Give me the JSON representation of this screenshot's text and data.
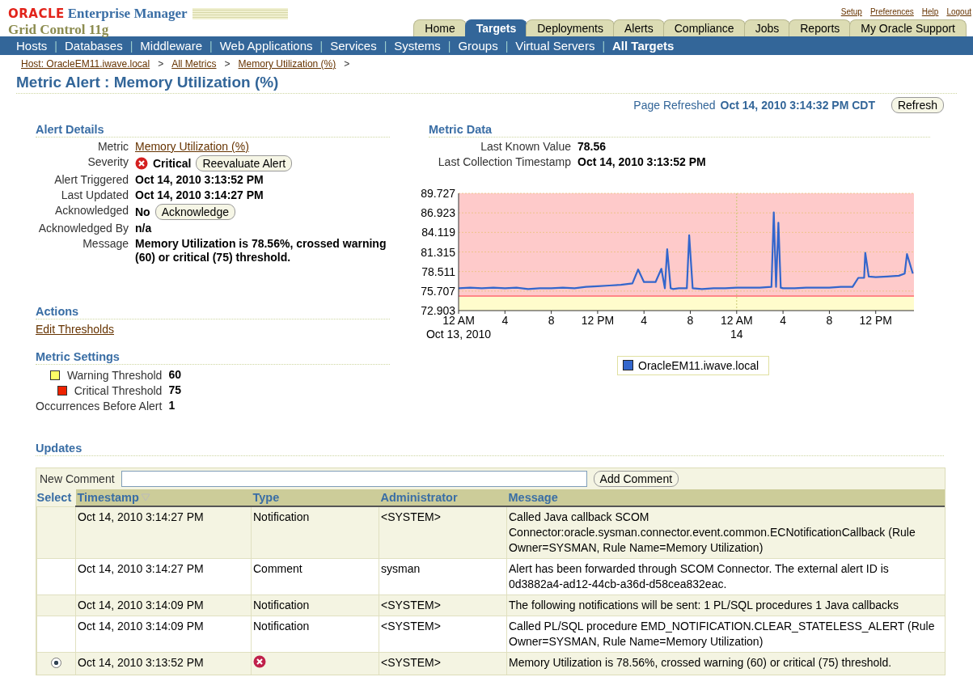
{
  "brand": {
    "vendor": "ORACLE",
    "product": "Enterprise Manager",
    "edition": "Grid Control 11g"
  },
  "global_links": [
    "Setup",
    "Preferences",
    "Help",
    "Logout"
  ],
  "tabs": [
    {
      "label": "Home",
      "selected": false
    },
    {
      "label": "Targets",
      "selected": true
    },
    {
      "label": "Deployments",
      "selected": false
    },
    {
      "label": "Alerts",
      "selected": false
    },
    {
      "label": "Compliance",
      "selected": false
    },
    {
      "label": "Jobs",
      "selected": false
    },
    {
      "label": "Reports",
      "selected": false
    },
    {
      "label": "My Oracle Support",
      "selected": false
    }
  ],
  "subnav": [
    {
      "label": "Hosts",
      "selected": false
    },
    {
      "label": "Databases",
      "selected": false
    },
    {
      "label": "Middleware",
      "selected": false
    },
    {
      "label": "Web Applications",
      "selected": false
    },
    {
      "label": "Services",
      "selected": false
    },
    {
      "label": "Systems",
      "selected": false
    },
    {
      "label": "Groups",
      "selected": false
    },
    {
      "label": "Virtual Servers",
      "selected": false
    },
    {
      "label": "All Targets",
      "selected": true
    }
  ],
  "breadcrumbs": [
    "Host: OracleEM11.iwave.local",
    "All Metrics",
    "Memory Utilization (%)"
  ],
  "subnav_separator": "|",
  "breadcrumb_separator": ">",
  "page_title": "Metric Alert : Memory Utilization (%)",
  "refresh": {
    "label": "Page Refreshed",
    "time": "Oct 14, 2010 3:14:32 PM CDT",
    "button": "Refresh"
  },
  "alert_details": {
    "title": "Alert Details",
    "rows": [
      {
        "label": "Metric",
        "value": "Memory Utilization (%)",
        "kind": "link"
      },
      {
        "label": "Severity",
        "value": "Critical",
        "kind": "severity",
        "button": "Reevaluate Alert"
      },
      {
        "label": "Alert Triggered",
        "value": "Oct 14, 2010 3:13:52 PM",
        "kind": "text"
      },
      {
        "label": "Last Updated",
        "value": "Oct 14, 2010 3:14:27 PM",
        "kind": "text"
      },
      {
        "label": "Acknowledged",
        "value": "No",
        "kind": "text",
        "button": "Acknowledge"
      },
      {
        "label": "Acknowledged By",
        "value": "n/a",
        "kind": "text"
      },
      {
        "label": "Message",
        "value": "Memory Utilization is 78.56%, crossed warning (60) or critical (75) threshold.",
        "kind": "text"
      }
    ]
  },
  "actions": {
    "title": "Actions",
    "links": [
      "Edit Thresholds"
    ]
  },
  "metric_settings": {
    "title": "Metric Settings",
    "rows": [
      {
        "label": "Warning Threshold",
        "value": "60",
        "kind": "swatch",
        "color": "#ffff66"
      },
      {
        "label": "Critical Threshold",
        "value": "75",
        "kind": "swatch",
        "color": "#ee2200"
      },
      {
        "label": "Occurrences Before Alert",
        "value": "1",
        "kind": "plain"
      }
    ]
  },
  "metric_data": {
    "title": "Metric Data",
    "rows": [
      {
        "label": "Last Known Value",
        "value": "78.56"
      },
      {
        "label": "Last Collection Timestamp",
        "value": "Oct 14, 2010 3:13:52 PM"
      }
    ],
    "chart_data": {
      "type": "line",
      "grid": true,
      "xlim": [
        "2010-10-13 00:00",
        "2010-10-14 15:18"
      ],
      "ylim": [
        72.903,
        89.727
      ],
      "yticks": [
        72.903,
        75.707,
        78.511,
        81.315,
        84.119,
        86.923,
        89.727
      ],
      "xticks": [
        {
          "value": "2010-10-13 00:00",
          "label": "12 AM\nOct 13, 2010"
        },
        {
          "value": "2010-10-13 04:00",
          "label": "4"
        },
        {
          "value": "2010-10-13 08:00",
          "label": "8"
        },
        {
          "value": "2010-10-13 12:00",
          "label": "12 PM"
        },
        {
          "value": "2010-10-13 16:00",
          "label": "4"
        },
        {
          "value": "2010-10-13 20:00",
          "label": "8"
        },
        {
          "value": "2010-10-14 00:00",
          "label": "12 AM\n14"
        },
        {
          "value": "2010-10-14 04:00",
          "label": "4"
        },
        {
          "value": "2010-10-14 08:00",
          "label": "8"
        },
        {
          "value": "2010-10-14 12:00",
          "label": "12 PM"
        }
      ],
      "x": [
        "2010-10-13 00:00",
        "2010-10-13 01:00",
        "2010-10-13 02:00",
        "2010-10-13 03:00",
        "2010-10-13 04:00",
        "2010-10-13 05:00",
        "2010-10-13 06:00",
        "2010-10-13 07:00",
        "2010-10-13 08:00",
        "2010-10-13 09:00",
        "2010-10-13 10:00",
        "2010-10-13 11:00",
        "2010-10-13 12:00",
        "2010-10-13 13:00",
        "2010-10-13 14:00",
        "2010-10-13 15:00",
        "2010-10-13 15:30",
        "2010-10-13 16:00",
        "2010-10-13 17:00",
        "2010-10-13 17:30",
        "2010-10-13 17:48",
        "2010-10-13 18:00",
        "2010-10-13 18:18",
        "2010-10-13 18:30",
        "2010-10-13 19:00",
        "2010-10-13 19:42",
        "2010-10-13 19:54",
        "2010-10-13 20:12",
        "2010-10-13 21:00",
        "2010-10-13 22:00",
        "2010-10-13 23:00",
        "2010-10-14 00:00",
        "2010-10-14 01:00",
        "2010-10-14 02:00",
        "2010-10-14 03:00",
        "2010-10-14 03:12",
        "2010-10-14 03:24",
        "2010-10-14 03:36",
        "2010-10-14 03:48",
        "2010-10-14 04:00",
        "2010-10-14 05:00",
        "2010-10-14 06:00",
        "2010-10-14 07:00",
        "2010-10-14 08:00",
        "2010-10-14 09:00",
        "2010-10-14 10:00",
        "2010-10-14 10:30",
        "2010-10-14 11:00",
        "2010-10-14 11:06",
        "2010-10-14 11:24",
        "2010-10-14 12:00",
        "2010-10-14 13:00",
        "2010-10-14 14:00",
        "2010-10-14 14:30",
        "2010-10-14 14:42",
        "2010-10-14 15:12"
      ],
      "series": [
        {
          "name": "OracleEM11.iwave.local",
          "color": "#3366cc",
          "values": [
            76.1,
            76.2,
            76.1,
            76.2,
            76.1,
            76.2,
            76.0,
            76.1,
            76.1,
            76.2,
            76.1,
            76.3,
            76.4,
            76.5,
            76.6,
            76.8,
            78.8,
            77.0,
            77.0,
            78.9,
            76.1,
            81.7,
            76.1,
            76.0,
            76.1,
            76.1,
            83.7,
            76.1,
            76.0,
            76.1,
            76.1,
            76.2,
            76.2,
            76.2,
            76.3,
            87.0,
            76.3,
            85.5,
            76.2,
            76.1,
            76.1,
            76.2,
            76.2,
            76.2,
            76.3,
            76.3,
            77.6,
            77.6,
            81.2,
            77.8,
            77.7,
            77.8,
            77.9,
            78.2,
            81.0,
            78.2
          ]
        }
      ],
      "bands": [
        {
          "axis": "y",
          "from": 75,
          "to": 89.727,
          "color": "#fecaca"
        },
        {
          "axis": "y",
          "from": 72.903,
          "to": 75,
          "color": "#fffccc"
        }
      ],
      "ref_lines": [
        {
          "axis": "y",
          "value": 75,
          "color": "#ff8888"
        },
        {
          "axis": "x",
          "value": "2010-10-14 00:00",
          "color": "#c8c870"
        }
      ]
    }
  },
  "updates": {
    "title": "Updates",
    "comment": {
      "label": "New Comment",
      "button": "Add Comment"
    },
    "columns": [
      {
        "label": "Select",
        "sorted": false
      },
      {
        "label": "Timestamp",
        "sorted": true
      },
      {
        "label": "Type",
        "sorted": false
      },
      {
        "label": "Administrator",
        "sorted": false
      },
      {
        "label": "Message",
        "sorted": false
      }
    ],
    "rows": [
      {
        "selectable": false,
        "selected": false,
        "timestamp": "Oct 14, 2010 3:14:27 PM",
        "kind": "text",
        "type": "Notification",
        "administrator": "<SYSTEM>",
        "message": "Called Java callback SCOM Connector:oracle.sysman.connector.event.common.ECNotificationCallback (Rule Owner=SYSMAN, Rule Name=Memory Utilization)"
      },
      {
        "selectable": false,
        "selected": false,
        "timestamp": "Oct 14, 2010 3:14:27 PM",
        "kind": "text",
        "type": "Comment",
        "administrator": "sysman",
        "message": "Alert has been forwarded through SCOM Connector. The external alert ID is 0d3882a4-ad12-44cb-a36d-d58cea832eac."
      },
      {
        "selectable": false,
        "selected": false,
        "timestamp": "Oct 14, 2010 3:14:09 PM",
        "kind": "text",
        "type": "Notification",
        "administrator": "<SYSTEM>",
        "message": "The following notifications will be sent: 1 PL/SQL procedures 1 Java callbacks"
      },
      {
        "selectable": false,
        "selected": false,
        "timestamp": "Oct 14, 2010 3:14:09 PM",
        "kind": "text",
        "type": "Notification",
        "administrator": "<SYSTEM>",
        "message": "Called PL/SQL procedure EMD_NOTIFICATION.CLEAR_STATELESS_ALERT (Rule Owner=SYSMAN, Rule Name=Memory Utilization)"
      },
      {
        "selectable": true,
        "selected": true,
        "timestamp": "Oct 14, 2010 3:13:52 PM",
        "kind": "severity",
        "administrator": "<SYSTEM>",
        "message": "Memory Utilization is 78.56%, crossed warning (60) or critical (75) threshold."
      }
    ]
  }
}
